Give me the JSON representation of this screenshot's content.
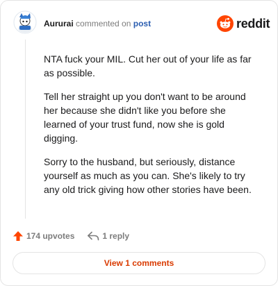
{
  "header": {
    "username": "Aururai",
    "commented_text": "commented on",
    "post_link": "post",
    "brand": "reddit"
  },
  "comment": {
    "paragraphs": [
      "NTA fuck your MIL. Cut her out of your life as far as possible.",
      "Tell her straight up you don't want to be around her because she didn't like you before she learned of your trust fund, now she is gold digging.",
      "Sorry to the husband, but seriously, distance yourself as much as you can. She's likely to try any old trick giving how other stories have been."
    ]
  },
  "actions": {
    "upvotes": "174 upvotes",
    "replies": "1 reply",
    "upvote_icon": "upvote-arrow-icon",
    "reply_icon": "reply-arrow-icon"
  },
  "footer": {
    "view_button": "View 1 comments"
  },
  "colors": {
    "reddit_orange": "#ff4500",
    "link_blue": "#2a5db0",
    "view_button_text": "#d93a00",
    "upvote_orange": "#ff4500"
  }
}
